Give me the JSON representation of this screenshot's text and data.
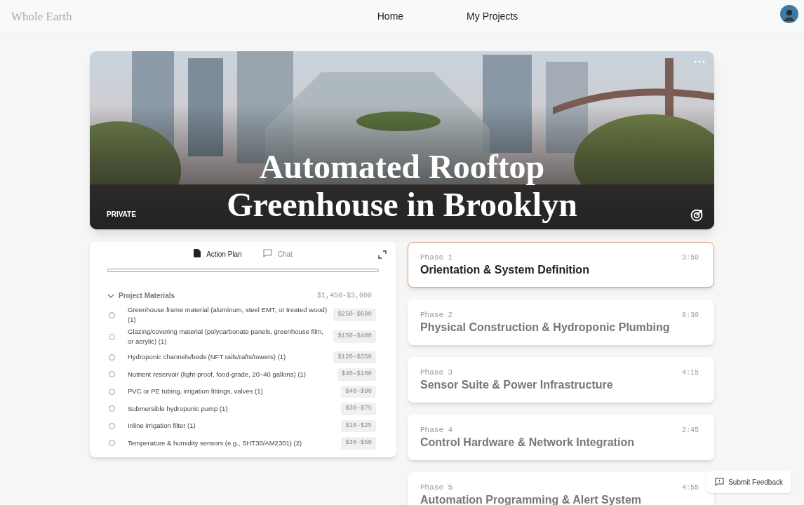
{
  "header": {
    "logo": "Whole Earth",
    "nav": [
      {
        "label": "Home"
      },
      {
        "label": "My Projects"
      }
    ]
  },
  "hero": {
    "title": "Automated Rooftop Greenhouse in Brooklyn",
    "visibility": "PRIVATE"
  },
  "panel": {
    "tabs": [
      {
        "label": "Action Plan",
        "selected": true
      },
      {
        "label": "Chat",
        "selected": false
      }
    ],
    "materials": {
      "title": "Project Materials",
      "expanded": true,
      "total": "$1,450-$3,000",
      "items": [
        {
          "name": "Greenhouse frame material (aluminum, steel EMT, or treated wood) (1)",
          "price": "$250-$600",
          "checked": false
        },
        {
          "name": "Glazing/covering material (polycarbonate panels, greenhouse film, or acrylic) (1)",
          "price": "$150-$400",
          "checked": false
        },
        {
          "name": "Hydroponic channels/beds (NFT rails/rafts/towers) (1)",
          "price": "$120-$350",
          "checked": false
        },
        {
          "name": "Nutrient reservoir (light-proof, food-grade, 20–40 gallons) (1)",
          "price": "$40-$100",
          "checked": false
        },
        {
          "name": "PVC or PE tubing, irrigation fittings, valves (1)",
          "price": "$40-$90",
          "checked": false
        },
        {
          "name": "Submersible hydroponic pump (1)",
          "price": "$30-$75",
          "checked": false
        },
        {
          "name": "Inline irrigation filter (1)",
          "price": "$10-$25",
          "checked": false
        },
        {
          "name": "Temperature & humidity sensors (e.g., SHT30/AM2301) (2)",
          "price": "$30-$60",
          "checked": false
        }
      ]
    }
  },
  "phases": [
    {
      "label": "Phase 1",
      "title": "Orientation & System Definition",
      "duration": "3:50",
      "selected": true
    },
    {
      "label": "Phase 2",
      "title": "Physical Construction & Hydroponic Plumbing",
      "duration": "8:30",
      "selected": false
    },
    {
      "label": "Phase 3",
      "title": "Sensor Suite & Power Infrastructure",
      "duration": "4:15",
      "selected": false
    },
    {
      "label": "Phase 4",
      "title": "Control Hardware & Network Integration",
      "duration": "2:45",
      "selected": false
    },
    {
      "label": "Phase 5",
      "title": "Automation Programming & Alert System",
      "duration": "4:55",
      "selected": false
    }
  ],
  "feedback_button": "Submit Feedback"
}
